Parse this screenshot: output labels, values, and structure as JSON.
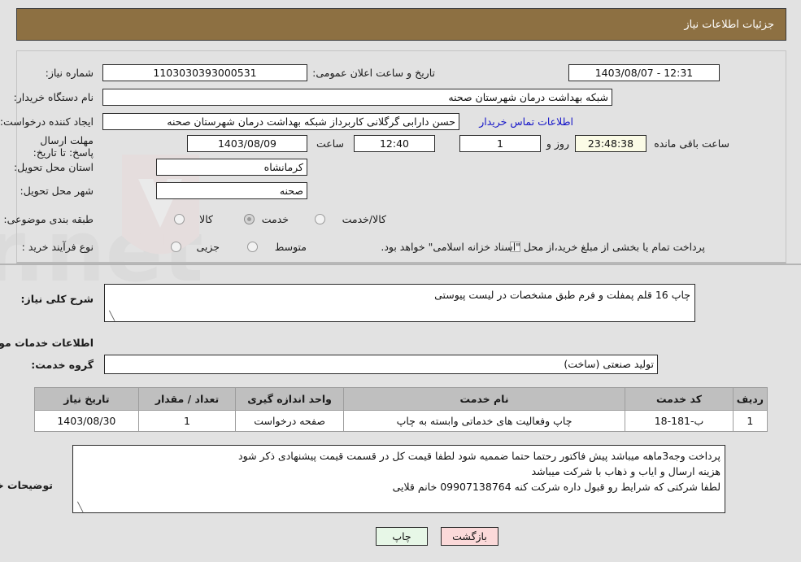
{
  "header": {
    "title": "جزئیات اطلاعات نیاز",
    "bar_color": "#8d7042"
  },
  "top_form": {
    "need_number_label": "شماره نیاز:",
    "need_number_value": "1103030393000531",
    "public_announce_label": "تاریخ و ساعت اعلان عمومی:",
    "public_announce_value": "12:31 - 1403/08/07",
    "buyer_org_label": "نام دستگاه خریدار:",
    "buyer_org_value": "شبکه بهداشت درمان شهرستان صحنه",
    "creator_label": "ایجاد کننده درخواست:",
    "creator_value": "حسن دارابی گرگلانی کاربرداز شبکه بهداشت درمان شهرستان صحنه",
    "contact_link": "اطلاعات تماس خریدار",
    "deadline_label": "مهلت ارسال پاسخ: تا تاریخ:",
    "deadline_date": "1403/08/09",
    "hour_label": "ساعت",
    "deadline_time": "12:40",
    "days_remaining": "1",
    "days_label": "روز و",
    "time_remaining": "23:48:38",
    "remaining_label": "ساعت باقی مانده",
    "province_label": "استان محل تحویل:",
    "province_value": "کرمانشاه",
    "city_label": "شهر محل تحویل:",
    "city_value": "صحنه",
    "category_label": "طبقه بندی موضوعی:",
    "category_options": [
      "کالا",
      "خدمت",
      "کالا/خدمت"
    ],
    "category_selected": "خدمت",
    "process_label": "نوع فرآیند خرید :",
    "process_options": [
      "جزیی",
      "متوسط"
    ],
    "process_selected": "",
    "treasury_checkbox_label": "پرداخت تمام یا بخشی از مبلغ خرید،از محل \"اسناد خزانه اسلامی\" خواهد بود.",
    "treasury_checked": false
  },
  "description": {
    "summary_label": "شرح کلی نیاز:",
    "summary_value": "چاپ 16 قلم پمفلت و فرم طبق مشخصات در لیست پیوستی",
    "section_title": "اطلاعات خدمات مورد نیاز",
    "service_group_label": "گروه خدمت:",
    "service_group_value": "تولید صنعتی (ساخت)"
  },
  "table": {
    "headers": [
      "ردیف",
      "کد خدمت",
      "نام خدمت",
      "واحد اندازه گیری",
      "تعداد / مقدار",
      "تاریخ نیاز"
    ],
    "rows": [
      {
        "row": "1",
        "service_code": "ب-181-18",
        "service_name": "چاپ وفعالیت های خدماتی وابسته به چاپ",
        "unit": "صفحه درخواست",
        "quantity": "1",
        "need_date": "1403/08/30"
      }
    ]
  },
  "buyer_notes": {
    "label": "توضیحات خریدار:",
    "lines": [
      "پرداخت وجه3ماهه میباشد پیش فاکتور رحتما حتما ضممیه شود لطفا قیمت کل در قسمت قیمت پیشنهادی ذکر شود",
      "هزینه ارسال و ایاب و ذهاب با شرکت میباشد",
      "لطفا شرکتی که شرایط رو قبول داره شرکت کنه 09907138764 خانم قلایی"
    ]
  },
  "footer": {
    "print_label": "چاپ",
    "back_label": "بازگشت"
  }
}
